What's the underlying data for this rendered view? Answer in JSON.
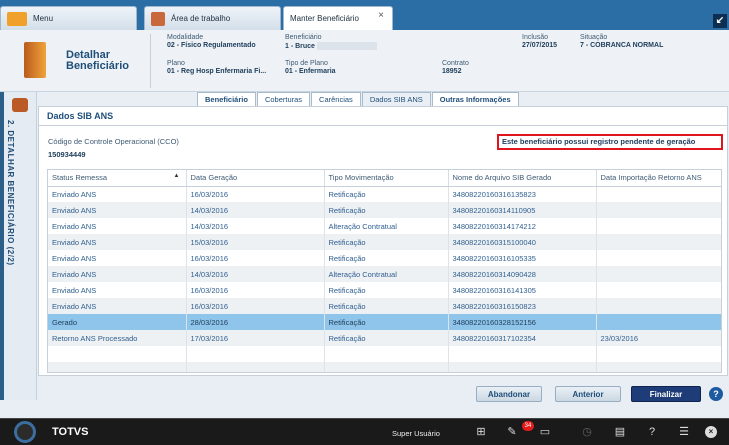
{
  "tabs": [
    {
      "label": "Menu"
    },
    {
      "label": "Área de trabalho"
    },
    {
      "label": "Manter Beneficiário"
    }
  ],
  "header": {
    "title": "Detalhar Beneficiário",
    "modalidade": {
      "label": "Modalidade",
      "value": "02 - Físico Regulamentado"
    },
    "beneficiario": {
      "label": "Beneficiário",
      "value": "1 - Bruce"
    },
    "inclusao": {
      "label": "Inclusão",
      "value": "27/07/2015"
    },
    "situacao": {
      "label": "Situação",
      "value": "7 - COBRANCA NORMAL"
    },
    "plano": {
      "label": "Plano",
      "value": "01 - Reg Hosp Enfermaria Fi..."
    },
    "tipo_plano": {
      "label": "Tipo de Plano",
      "value": "01 - Enfermaria"
    },
    "contrato": {
      "label": "Contrato",
      "value": "18952"
    }
  },
  "rail": {
    "label": "2. DETALHAR BENEFICIÁRIO (2/2)"
  },
  "inner_tabs": [
    {
      "label": "Beneficiário"
    },
    {
      "label": "Coberturas"
    },
    {
      "label": "Carências"
    },
    {
      "label": "Dados SIB ANS"
    },
    {
      "label": "Outras Informações"
    }
  ],
  "section": {
    "title": "Dados SIB ANS",
    "cco_label": "Código de Controle Operacional (CCO)",
    "cco_value": "150934449",
    "alert": "Este beneficiário possui registro pendente de geração"
  },
  "table": {
    "columns": [
      "Status Remessa",
      "Data Geração",
      "Tipo Movimentação",
      "Nome do Arquivo SIB Gerado",
      "Data Importação Retorno ANS"
    ],
    "rows": [
      [
        "Enviado ANS",
        "16/03/2016",
        "Retificação",
        "34808220160316135823",
        ""
      ],
      [
        "Enviado ANS",
        "14/03/2016",
        "Retificação",
        "34808220160314110905",
        ""
      ],
      [
        "Enviado ANS",
        "14/03/2016",
        "Alteração Contratual",
        "34808220160314174212",
        ""
      ],
      [
        "Enviado ANS",
        "15/03/2016",
        "Retificação",
        "34808220160315100040",
        ""
      ],
      [
        "Enviado ANS",
        "16/03/2016",
        "Retificação",
        "34808220160316105335",
        ""
      ],
      [
        "Enviado ANS",
        "14/03/2016",
        "Alteração Contratual",
        "34808220160314090428",
        ""
      ],
      [
        "Enviado ANS",
        "16/03/2016",
        "Retificação",
        "34808220160316141305",
        ""
      ],
      [
        "Enviado ANS",
        "16/03/2016",
        "Retificação",
        "34808220160316150823",
        ""
      ],
      [
        "Gerado",
        "28/03/2016",
        "Retificação",
        "34808220160328152156",
        ""
      ],
      [
        "Retorno ANS Processado",
        "17/03/2016",
        "Retificação",
        "34808220160317102354",
        "23/03/2016"
      ]
    ],
    "selected_row": 8
  },
  "buttons": {
    "abandonar": "Abandonar",
    "anterior": "Anterior",
    "finalizar": "Finalizar"
  },
  "bottombar": {
    "brand": "TOTVS",
    "user": "Super Usuário",
    "notifications": "34"
  }
}
